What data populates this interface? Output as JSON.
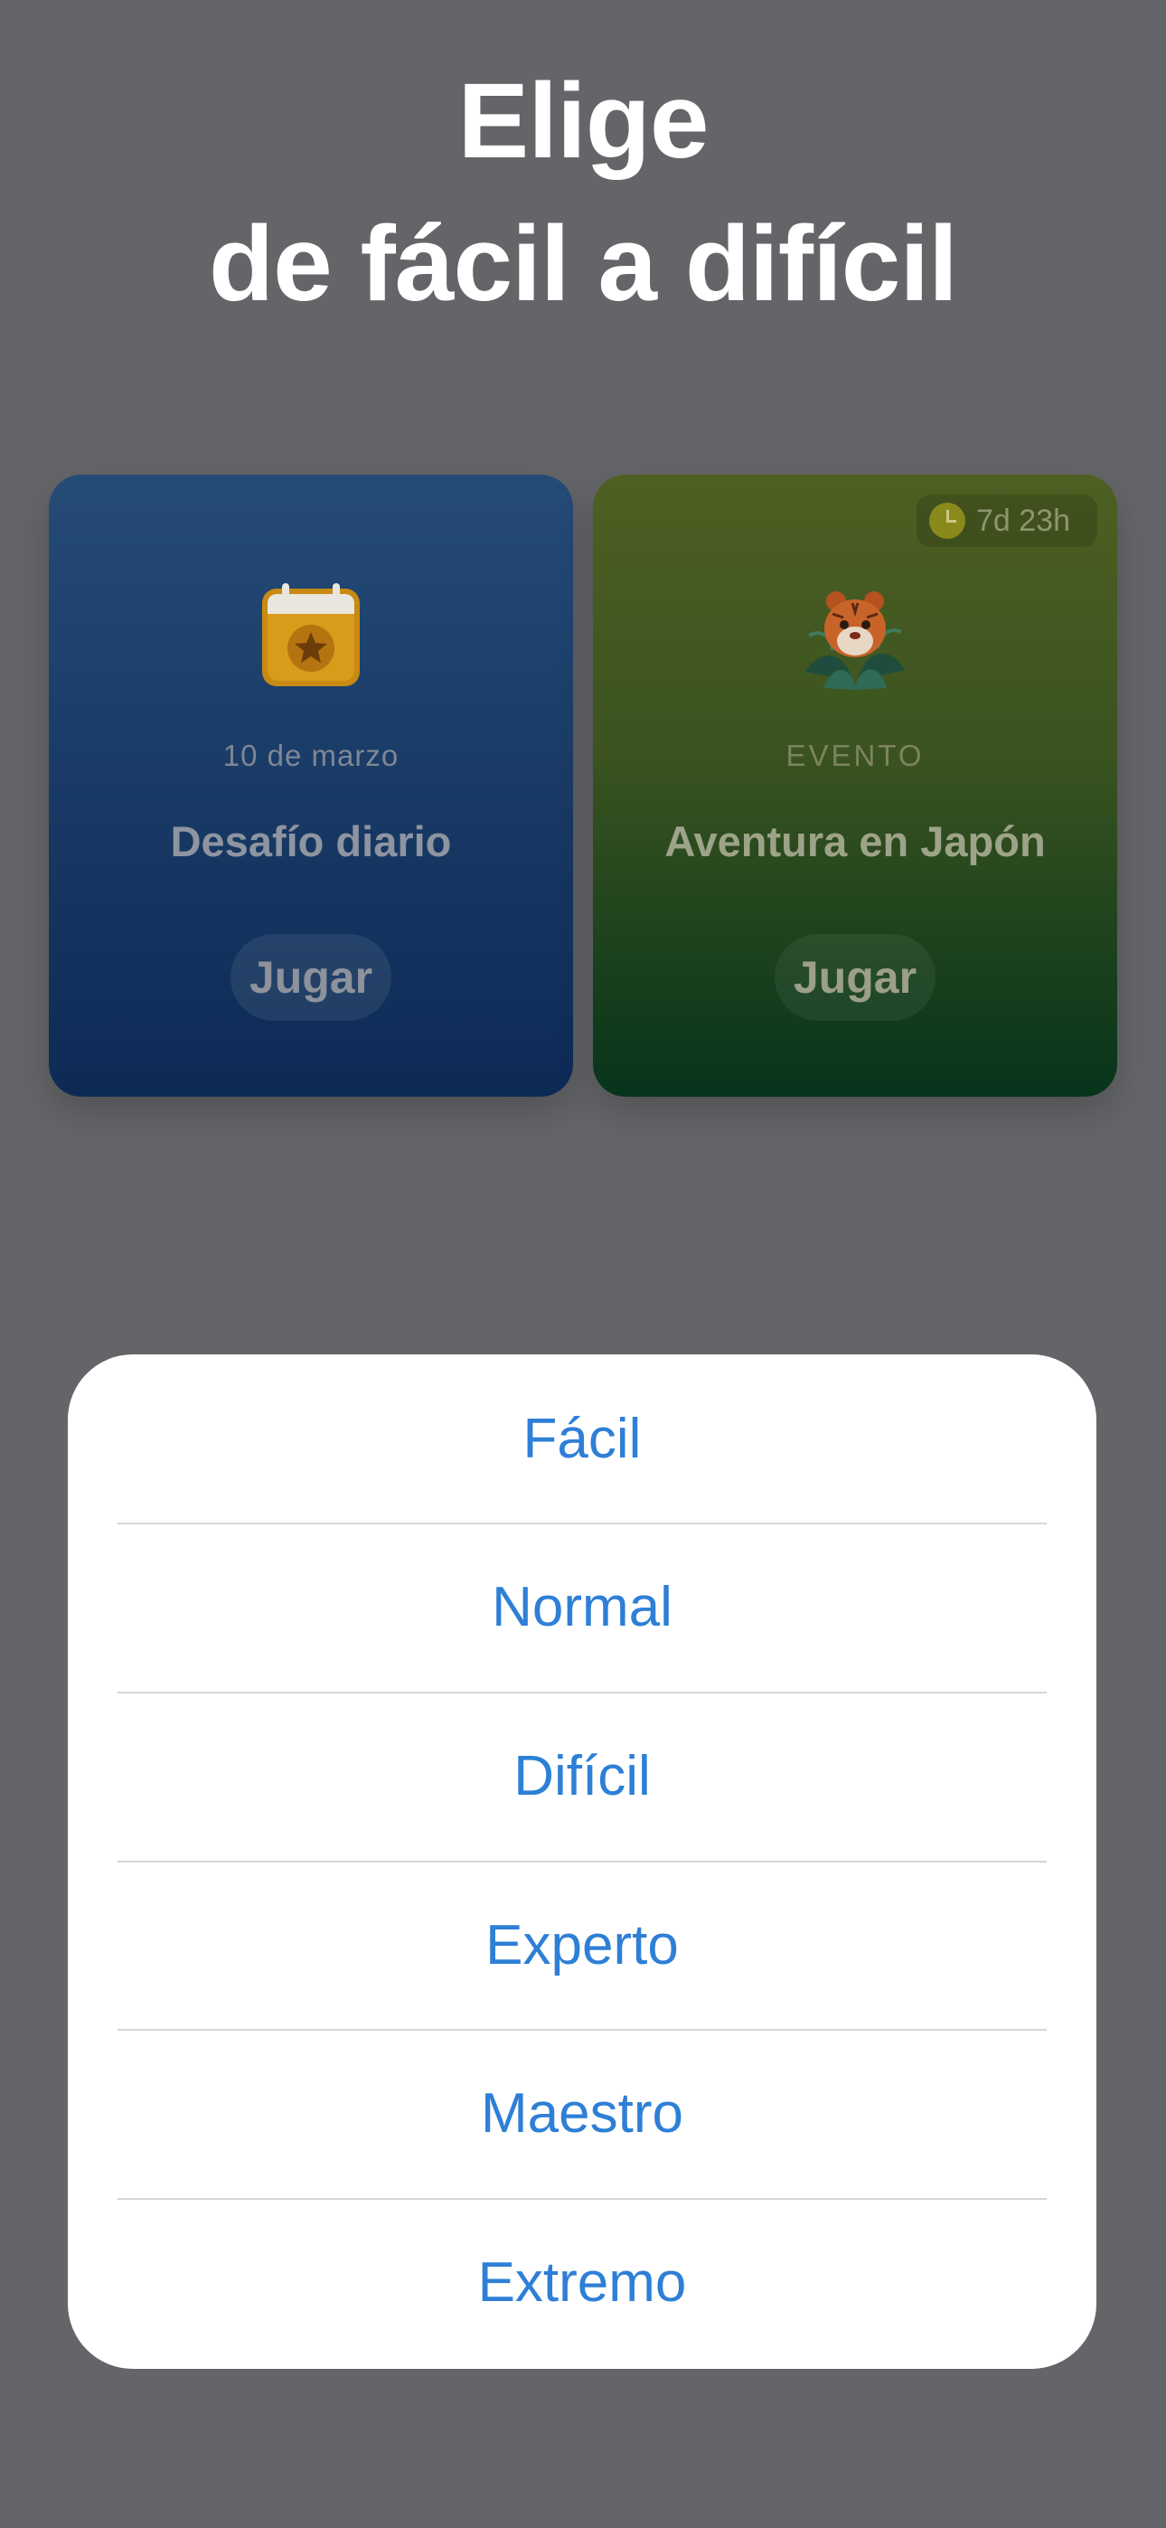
{
  "headline": {
    "line1": "Elige",
    "line2": "de fácil a difícil"
  },
  "cards": [
    {
      "icon": "calendar-star-icon",
      "subtitle": "10 de marzo",
      "title": "Desafío diario",
      "button": "Jugar"
    },
    {
      "icon": "tiger-leaves-icon",
      "badge": "7d 23h",
      "subtitle": "EVENTO",
      "title": "Aventura en Japón",
      "button": "Jugar"
    }
  ],
  "difficulty_sheet": {
    "options": [
      "Fácil",
      "Normal",
      "Difícil",
      "Experto",
      "Maestro",
      "Extremo"
    ],
    "accent_color": "#2e7fd6"
  }
}
